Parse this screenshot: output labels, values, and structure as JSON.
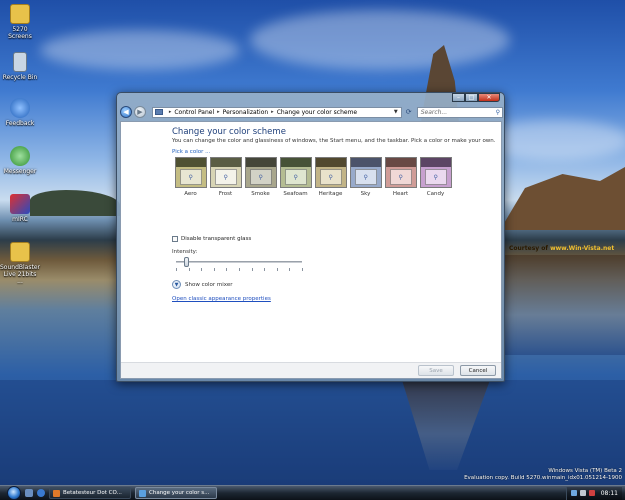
{
  "desktop_icons": [
    {
      "label": "5270 Screens",
      "icon": "folder-icon",
      "color": "#e8c24a"
    },
    {
      "label": "Recycle Bin",
      "icon": "recycle-bin-icon",
      "color": "#c9d6e4"
    },
    {
      "label": "Feedback",
      "icon": "feedback-icon",
      "color": "#2f6ec4"
    },
    {
      "label": "Messenger",
      "icon": "messenger-icon",
      "color": "#3fae3f"
    },
    {
      "label": "mIRC",
      "icon": "mirc-icon",
      "color": "#2a4bbf"
    },
    {
      "label": "SoundBlaster Live 21bits ...",
      "icon": "folder-icon",
      "color": "#e8c24a"
    }
  ],
  "window": {
    "breadcrumb": [
      "Control Panel",
      "Personalization",
      "Change your color scheme"
    ],
    "search_placeholder": "Search...",
    "heading": "Change your color scheme",
    "description": "You can change the color and glassiness of windows, the Start menu, and the taskbar. Pick a color or make your own.",
    "pick_label": "Pick a color ...",
    "swatches": [
      {
        "name": "Aero",
        "top": "#4f5132",
        "body": "#c4bd83",
        "win": "#e8e6d2"
      },
      {
        "name": "Frost",
        "top": "#5a5d44",
        "body": "#d7d4b4",
        "win": "#f4f3ea"
      },
      {
        "name": "Smoke",
        "top": "#454639",
        "body": "#a8a68c",
        "win": "#d2d2c6"
      },
      {
        "name": "Seafoam",
        "top": "#475237",
        "body": "#b4bc92",
        "win": "#dfe6d0"
      },
      {
        "name": "Heritage",
        "top": "#52492f",
        "body": "#c2b487",
        "win": "#e9e2cb"
      },
      {
        "name": "Sky",
        "top": "#4b536a",
        "body": "#98aacb",
        "win": "#d8e0ef"
      },
      {
        "name": "Heart",
        "top": "#684944",
        "body": "#d09c97",
        "win": "#f0d8d6"
      },
      {
        "name": "Candy",
        "top": "#5c4564",
        "body": "#c7a0cf",
        "win": "#ebd9ef"
      }
    ],
    "disable_glass_label": "Disable transparent glass",
    "intensity_label": "Intensity:",
    "intensity_value": 0.08,
    "mixer_label": "Show color mixer",
    "classic_link": "Open classic appearance properties",
    "save_label": "Save",
    "cancel_label": "Cancel"
  },
  "watermark": {
    "courtesy": "Courtesy of",
    "site": "www.Win-Vista.net",
    "build_line1": "Windows Vista (TM) Beta 2",
    "build_line2": "Evaluation copy. Build 5270.winmain_idx01.051214-1900"
  },
  "taskbar": {
    "tasks": [
      {
        "label": "Betatesteur Dot CO...",
        "active": false,
        "color": "#e07a2a"
      },
      {
        "label": "Change your color s...",
        "active": true,
        "color": "#5aa0e0"
      }
    ],
    "clock": "08:11"
  }
}
